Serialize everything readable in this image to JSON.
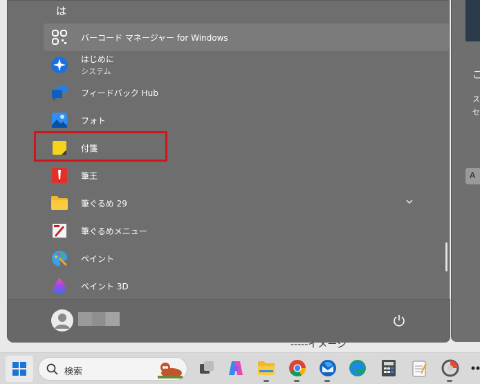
{
  "start_menu": {
    "letter_header": "は",
    "apps": [
      {
        "label": "バーコード マネージャー for Windows",
        "sub": "",
        "icon": "qr-scanner-icon"
      },
      {
        "label": "はじめに",
        "sub": "システム",
        "icon": "get-started-icon"
      },
      {
        "label": "フィードバック Hub",
        "sub": "",
        "icon": "feedback-hub-icon"
      },
      {
        "label": "フォト",
        "sub": "",
        "icon": "photos-icon"
      },
      {
        "label": "付箋",
        "sub": "",
        "icon": "sticky-notes-icon"
      },
      {
        "label": "筆王",
        "sub": "",
        "icon": "fudeou-icon"
      },
      {
        "label": "筆ぐるめ 29",
        "sub": "",
        "icon": "folder-icon"
      },
      {
        "label": "筆ぐるめメニュー",
        "sub": "",
        "icon": "fudegurume-menu-icon"
      },
      {
        "label": "ペイント",
        "sub": "",
        "icon": "paint-icon"
      },
      {
        "label": "ペイント 3D",
        "sub": "",
        "icon": "paint-3d-icon"
      }
    ],
    "footer": {
      "user_name": "",
      "power_icon": "power-icon"
    }
  },
  "taskbar": {
    "search_label": "検索",
    "icons": [
      "windows-start-icon",
      "search-icon",
      "task-view-icon",
      "copilot-icon",
      "file-explorer-icon",
      "chrome-icon",
      "thunderbird-icon",
      "edge-icon",
      "calculator-icon",
      "notepad-icon",
      "snipping-tool-icon"
    ]
  },
  "background": {
    "doc_text": "-----イメージ",
    "right_text_1": "こ",
    "right_text_2": "ス",
    "right_text_3": "セ",
    "right_pill": "A"
  },
  "colors": {
    "highlight": "#d0141b",
    "menu_bg": "#6e6e6e"
  }
}
